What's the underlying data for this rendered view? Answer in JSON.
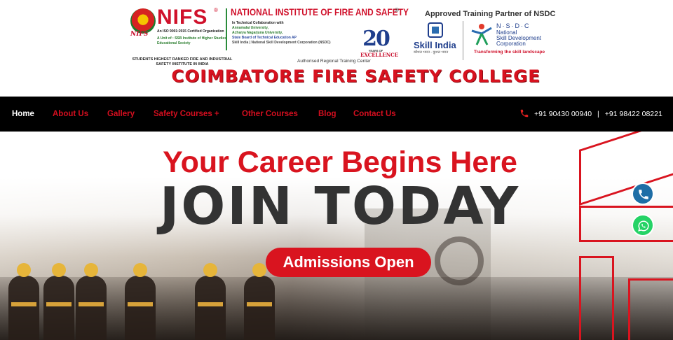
{
  "header": {
    "nifs_word": "NIFS",
    "nifs_reg": "®",
    "nifs_logo_sub": "NIFS",
    "iso": "An ISO 9001:2015 Certified Organization",
    "unit": "A Unit of : SSB Institute of Higher Studies Educational Society",
    "institute_title": "NATIONAL INSTITUTE OF FIRE AND SAFETY",
    "institute_reg": "®",
    "collab": [
      "In Technical Collaboration with",
      "Annamalai University,",
      "Acharya Nagarjuna University,",
      "State Board of Technical Education AP",
      "Skill India | National Skill Development Corporation (NSDC)"
    ],
    "badge_number": "20",
    "badge_sub": "YEARS OF",
    "badge_label": "EXCELLENCE",
    "approved": "Approved Training Partner of NSDC",
    "skill_india": "Skill India",
    "skill_india_tag": "कौशल भारत - कुशल भारत",
    "nsdc_abbr": "N·S·D·C",
    "nsdc_full": [
      "National",
      "Skill Development",
      "Corporation"
    ],
    "nsdc_tag": "Transforming the skill landscape",
    "ranked": "STUDENTS HIGHEST RANKED FIRE AND INDUSTRIAL SAFETY INSTITUTE IN INDIA",
    "authorised": "Authorised Regional Training Center",
    "college": "COIMBATORE FIRE SAFETY COLLEGE"
  },
  "nav": {
    "items": [
      "Home",
      "About Us",
      "Gallery",
      "Safety Courses +",
      "Other Courses",
      "Blog",
      "Contact Us"
    ],
    "phone_1": "+91 90430 00940",
    "separator": "|",
    "phone_2": "+91 98422 08221"
  },
  "hero": {
    "tagline": "Your Career Begins Here",
    "headline": "JOIN TODAY",
    "cta": "Admissions Open"
  },
  "colors": {
    "brand_red": "#d9141f",
    "nav_bg": "#000000",
    "call_button": "#1e6ea6",
    "whatsapp_button": "#25d366"
  },
  "icons": {
    "phone": "phone-icon",
    "call_float": "phone-icon",
    "whatsapp_float": "whatsapp-icon"
  }
}
